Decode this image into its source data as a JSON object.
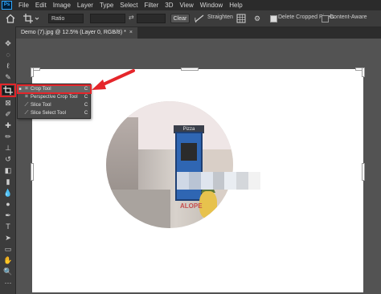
{
  "menubar": {
    "logo": "Ps",
    "items": [
      "File",
      "Edit",
      "Image",
      "Layer",
      "Type",
      "Select",
      "Filter",
      "3D",
      "View",
      "Window",
      "Help"
    ]
  },
  "options": {
    "ratio_value": "Ratio",
    "swap_symbol": "⇄",
    "clear_label": "Clear",
    "straighten_label": "Straighten",
    "delete_cropped_label": "Delete Cropped Pixels",
    "content_aware_label": "Content-Aware",
    "delete_cropped_checked": true,
    "content_aware_checked": false
  },
  "document": {
    "tab_title": "Demo (7).jpg @ 12.5% (Layer 0, RGB/8) *",
    "close_symbol": "×"
  },
  "photo": {
    "sign_text": "Pizza",
    "graffiti_text": "ALOPE"
  },
  "flyout": {
    "items": [
      {
        "label": "Crop Tool",
        "key": "C",
        "icon": "crop-icon",
        "selected": true
      },
      {
        "label": "Perspective Crop Tool",
        "key": "C",
        "icon": "perspective-crop-icon",
        "selected": false
      },
      {
        "label": "Slice Tool",
        "key": "C",
        "icon": "slice-icon",
        "selected": false
      },
      {
        "label": "Slice Select Tool",
        "key": "C",
        "icon": "slice-select-icon",
        "selected": false
      }
    ]
  },
  "colors": {
    "highlight": "#e5262b",
    "arrow": "#e5262b",
    "menubar_bg": "#2b2b2b",
    "panel_bg": "#3c3c3c",
    "workspace_bg": "#535353"
  }
}
